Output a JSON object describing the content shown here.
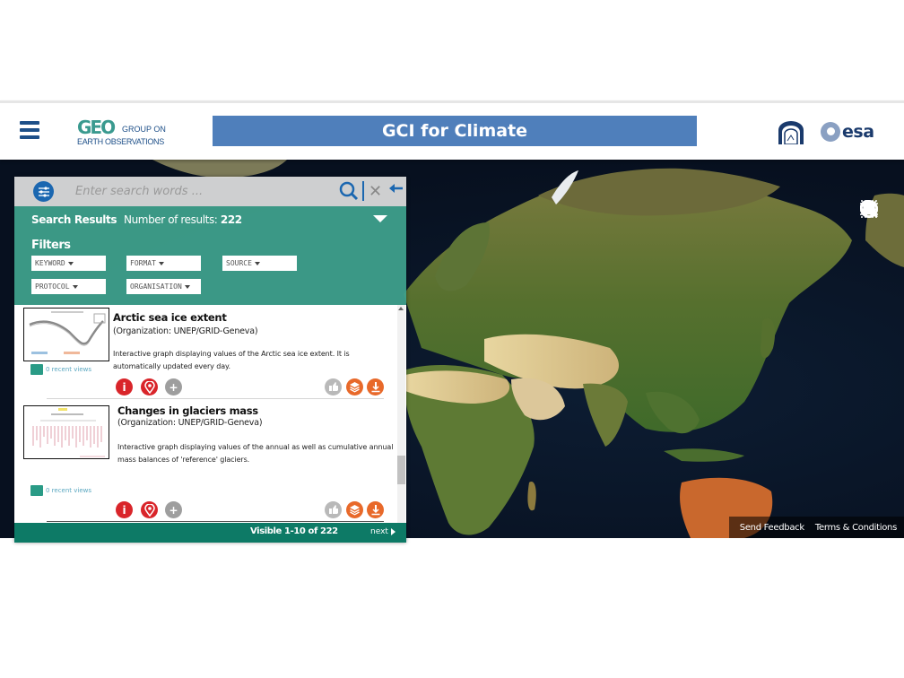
{
  "header": {
    "menu_icon": "hamburger-menu-icon",
    "geo_logo": {
      "mark": "GEO",
      "line1": "GROUP ON",
      "line2": "EARTH OBSERVATIONS"
    },
    "title": "GCI for Climate",
    "partner_logos": [
      {
        "name": "CNR",
        "icon": "cnr-logo"
      },
      {
        "name": "esa",
        "icon": "esa-logo"
      }
    ]
  },
  "search": {
    "placeholder": "Enter search words ...",
    "value": "",
    "filter_icon": "filter-settings-icon",
    "search_icon": "magnifier-icon",
    "clear_icon": "close-icon",
    "back_icon": "arrow-left-icon"
  },
  "results_header": {
    "title": "Search Results",
    "count_label": "Number of results:",
    "count": "222",
    "filters_title": "Filters",
    "filters": [
      {
        "label": "KEYWORD"
      },
      {
        "label": "FORMAT"
      },
      {
        "label": "SOURCE"
      },
      {
        "label": "PROTOCOL"
      },
      {
        "label": "ORGANISATION"
      }
    ]
  },
  "results": [
    {
      "title": "Arctic sea ice extent",
      "organization": "(Organization: UNEP/GRID-Geneva)",
      "description": "Interactive graph displaying values of the Arctic sea ice extent. It is automatically updated every day.",
      "views": "0 recent views",
      "actions_left": [
        "info-icon",
        "map-pin-icon",
        "plus-icon"
      ],
      "actions_right": [
        "thumbs-up-icon",
        "layers-icon",
        "download-icon"
      ]
    },
    {
      "title": "Changes in glaciers mass",
      "organization": "(Organization: UNEP/GRID-Geneva)",
      "description": "Interactive graph displaying values of the annual as well as cumulative annual mass balances of 'reference' glaciers.",
      "views": "0 recent views",
      "actions_left": [
        "info-icon",
        "map-pin-icon",
        "plus-icon"
      ],
      "actions_right": [
        "thumbs-up-icon",
        "layers-icon",
        "download-icon"
      ]
    }
  ],
  "pagination": {
    "visible": "Visible 1-10 of 222",
    "next": "next"
  },
  "map": {
    "controls": [
      "zoom-in-icon",
      "zoom-out-icon",
      "pan-icon",
      "select-area-icon",
      "layers-icon",
      "map-legend-icon"
    ],
    "footer_links": [
      "Send Feedback",
      "Terms & Conditions"
    ]
  },
  "colors": {
    "banner": "#4f7fbb",
    "teal_header": "#3fa08c",
    "footer_green": "#0d7a66",
    "action_red": "#d9252a",
    "action_orange": "#e8692a",
    "brand_blue": "#1d4f88"
  }
}
